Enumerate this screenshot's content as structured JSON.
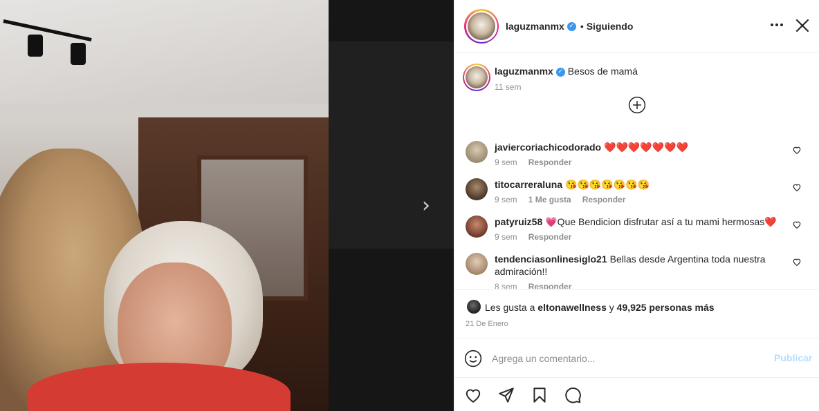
{
  "media": {
    "next_arrow": "›"
  },
  "header": {
    "username": "laguzmanmx",
    "separator": "•",
    "follow_status": "Siguiendo"
  },
  "caption": {
    "username": "laguzmanmx",
    "text": "Besos de mamá",
    "time": "11 sem"
  },
  "comments": [
    {
      "username": "javiercoriachicodorado",
      "text": "❤️❤️❤️❤️❤️❤️❤️",
      "time": "9 sem",
      "likes": "",
      "reply": "Responder",
      "avatar_color": "#9a8a70"
    },
    {
      "username": "titocarreraluna",
      "text": "😘😘😘😘😘😘😘",
      "time": "9 sem",
      "likes": "1 Me gusta",
      "reply": "Responder",
      "avatar_color": "#5b4636"
    },
    {
      "username": "patyruiz58",
      "text": "💗Que Bendicion disfrutar así a tu mami hermosas❤️",
      "time": "9 sem",
      "likes": "",
      "reply": "Responder",
      "avatar_color": "#8a4b3c"
    },
    {
      "username": "tendenciasonlinesiglo21",
      "text": "Bellas desde Argentina toda nuestra admiración!!",
      "time": "8 sem",
      "likes": "",
      "reply": "Responder",
      "avatar_color": "#b79a7e"
    }
  ],
  "likes": {
    "prefix": "Les gusta a",
    "user": "eltonawellness",
    "connector": "y",
    "others": "49,925 personas más"
  },
  "date": "21 De Enero",
  "comment_box": {
    "placeholder": "Agrega un comentario...",
    "publish_label": "Publicar"
  },
  "colors": {
    "verified": "#3897f0",
    "publish_disabled": "#b2dffc",
    "secondary_text": "#8e8e8e"
  }
}
